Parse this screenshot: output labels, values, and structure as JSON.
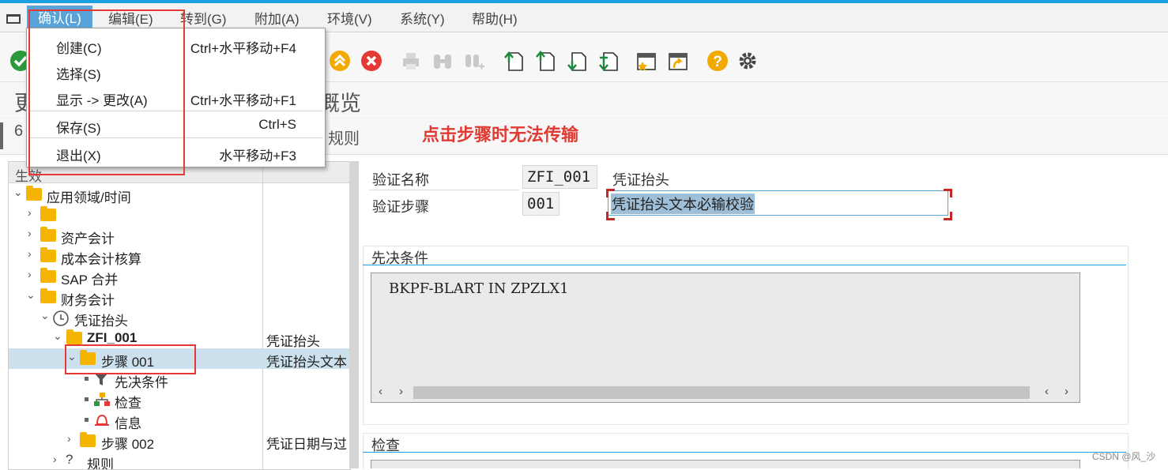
{
  "menubar": {
    "items": [
      {
        "label": "确认(L)"
      },
      {
        "label": "编辑(E)"
      },
      {
        "label": "转到(G)"
      },
      {
        "label": "附加(A)"
      },
      {
        "label": "环境(V)"
      },
      {
        "label": "系统(Y)"
      },
      {
        "label": "帮助(H)"
      }
    ]
  },
  "dropdown": {
    "items": [
      {
        "label": "创建(C)",
        "shortcut": "Ctrl+水平移动+F4"
      },
      {
        "label": "选择(S)",
        "shortcut": ""
      },
      {
        "label": "显示 -> 更改(A)",
        "shortcut": "Ctrl+水平移动+F1"
      },
      {
        "label": "保存(S)",
        "shortcut": "Ctrl+S"
      },
      {
        "label": "退出(X)",
        "shortcut": "水平移动+F3"
      }
    ]
  },
  "title": {
    "left_char": "更",
    "right_text": "概览"
  },
  "appbar": {
    "left_icon_char": "6",
    "rules_label": "规则"
  },
  "annotation": "点击步骤时无法传输",
  "tree": {
    "header": "生效",
    "rows": [
      {
        "label": "应用领域/时间",
        "desc": ""
      },
      {
        "label": "",
        "desc": ""
      },
      {
        "label": "资产会计",
        "desc": ""
      },
      {
        "label": "成本会计核算",
        "desc": ""
      },
      {
        "label": "SAP 合并",
        "desc": ""
      },
      {
        "label": "财务会计",
        "desc": ""
      },
      {
        "label": "凭证抬头",
        "desc": ""
      },
      {
        "label": "ZFI_001",
        "desc": "凭证抬头"
      },
      {
        "label": "步骤 001",
        "desc": "凭证抬头文本"
      },
      {
        "label": "先决条件",
        "desc": ""
      },
      {
        "label": "检查",
        "desc": ""
      },
      {
        "label": "信息",
        "desc": ""
      },
      {
        "label": "步骤 002",
        "desc": "凭证日期与过"
      },
      {
        "label": "规则",
        "desc": ""
      }
    ]
  },
  "detail": {
    "validation_name_label": "验证名称",
    "validation_name_value": "ZFI_001",
    "validation_name_desc": "凭证抬头",
    "step_label": "验证步骤",
    "step_value": "001",
    "step_desc_value": "凭证抬头文本必输校验",
    "prereq_title": "先决条件",
    "prereq_text": "BKPF-BLART IN ZPZLX1",
    "check_title": "检查"
  },
  "watermark": "CSDN @风_沙",
  "colors": {
    "accent": "#1a9fe0",
    "annotation_red": "#e03a32",
    "selection": "#cce0ee",
    "folder": "#f5b400"
  }
}
